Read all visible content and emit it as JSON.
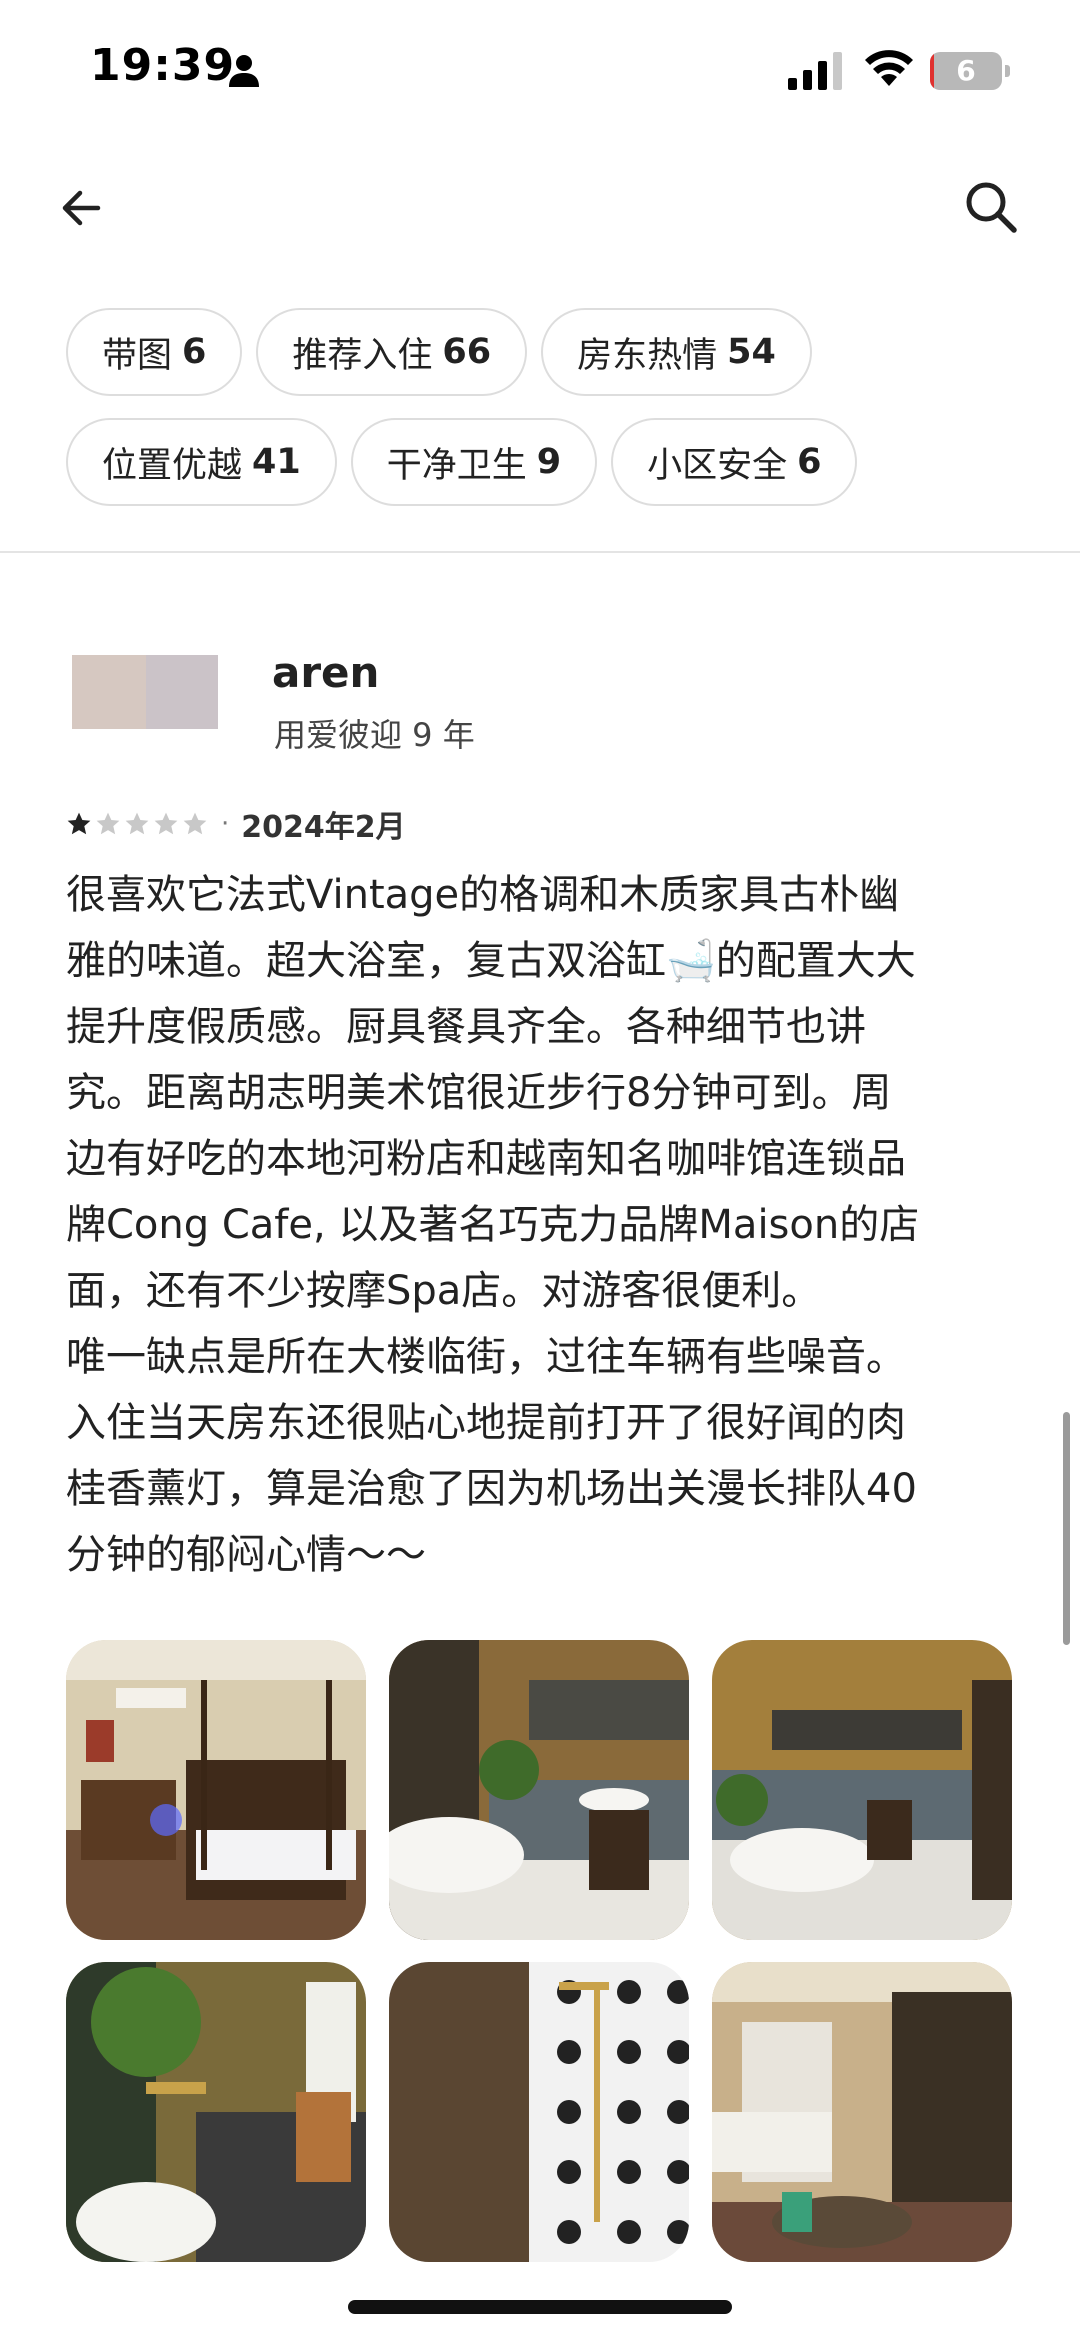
{
  "status_bar": {
    "time": "19:39",
    "battery_level": "6",
    "battery_fraction": 0.06,
    "icons": [
      "person-icon",
      "signal-icon",
      "wifi-icon",
      "battery-icon"
    ]
  },
  "nav": {
    "back_icon": "arrow-left-icon",
    "search_icon": "search-icon"
  },
  "filters": [
    {
      "label": "带图",
      "count": "6"
    },
    {
      "label": "推荐入住",
      "count": "66"
    },
    {
      "label": "房东热情",
      "count": "54"
    },
    {
      "label": "位置优越",
      "count": "41"
    },
    {
      "label": "干净卫生",
      "count": "9"
    },
    {
      "label": "小区安全",
      "count": "6"
    }
  ],
  "review": {
    "reviewer_name": "aren",
    "reviewer_tenure": "用爱彼迎 9 年",
    "rating": 1,
    "rating_max": 5,
    "separator": "·",
    "date": "2024年2月",
    "lines": [
      "很喜欢它法式Vintage的格调和木质家具古朴幽",
      "雅的味道。超大浴室，复古双浴缸🛁的配置大大",
      "提升度假质感。厨具餐具齐全。各种细节也讲",
      "究。距离胡志明美术馆很近步行8分钟可到。周",
      "边有好吃的本地河粉店和越南知名咖啡馆连锁品",
      "牌Cong Cafe, 以及著名巧克力品牌Maison的店",
      "面，还有不少按摩Spa店。对游客很便利。",
      "唯一缺点是所在大楼临街，过往车辆有些噪音。",
      "入住当天房东还很贴心地提前打开了很好闻的肉",
      "桂香薰灯，算是治愈了因为机场出关漫长排队40",
      "分钟的郁闷心情～～"
    ]
  },
  "colors": {
    "chip_border": "#dddddd",
    "text": "#222222",
    "star_filled": "#222222",
    "star_empty": "#c8c8c8",
    "battery_low": "#e0312f"
  }
}
